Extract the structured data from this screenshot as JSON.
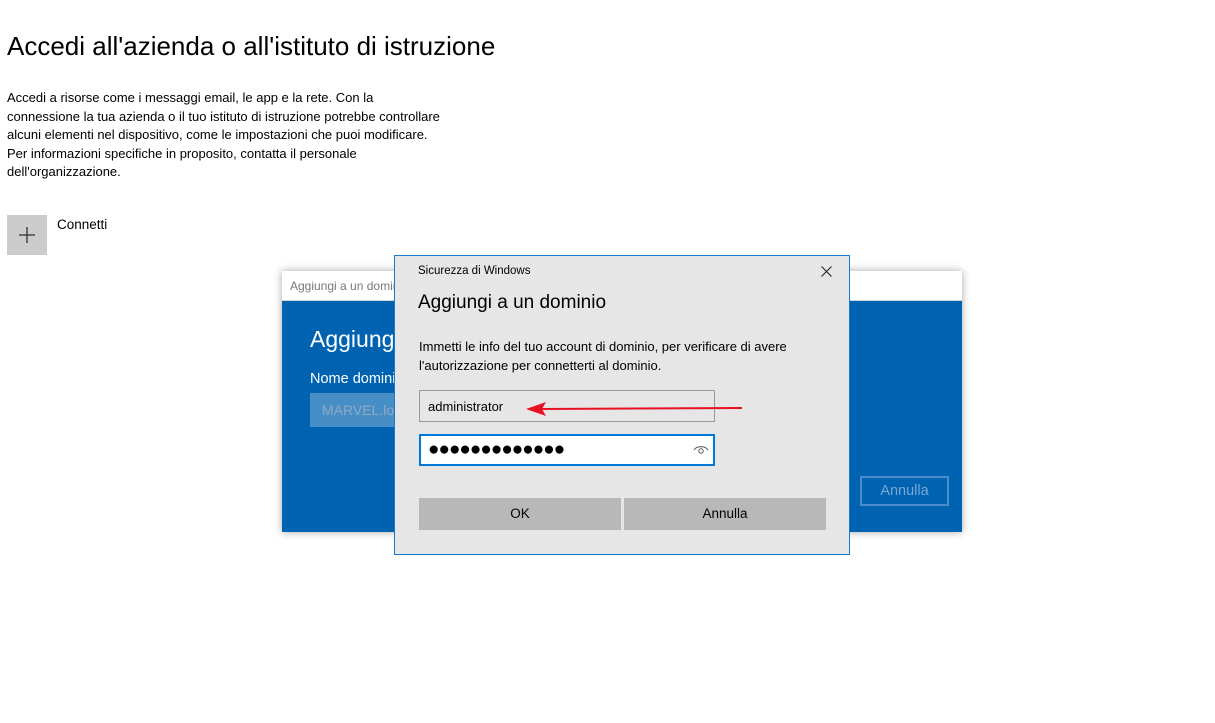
{
  "page": {
    "title": "Accedi all'azienda o all'istituto di istruzione",
    "description": "Accedi a risorse come i messaggi email, le app e la rete. Con la connessione la tua azienda o il tuo istituto di istruzione potrebbe controllare alcuni elementi nel dispositivo, come le impostazioni che puoi modificare. Per informazioni specifiche in proposito, contatta il personale dell'organizzazione.",
    "connect_label": "Connetti",
    "connect_icon": "plus-icon"
  },
  "background_dialog": {
    "title": "Aggiungi a un dominio",
    "heading": "Aggiungi a un dominio",
    "domain_label": "Nome dominio",
    "domain_value": "MARVEL.local",
    "cancel_label": "Annulla"
  },
  "security_dialog": {
    "window_title": "Sicurezza di Windows",
    "heading": "Aggiungi a un dominio",
    "description": "Immetti le info del tuo account di dominio, per verificare di avere l'autorizzazione per connetterti al dominio.",
    "username_value": "administrator",
    "password_value": "●●●●●●●●●●●●●",
    "ok_label": "OK",
    "cancel_label": "Annulla",
    "close_icon": "close-icon",
    "reveal_icon": "eye-icon"
  },
  "annotation": {
    "arrow_color": "#e81123"
  }
}
